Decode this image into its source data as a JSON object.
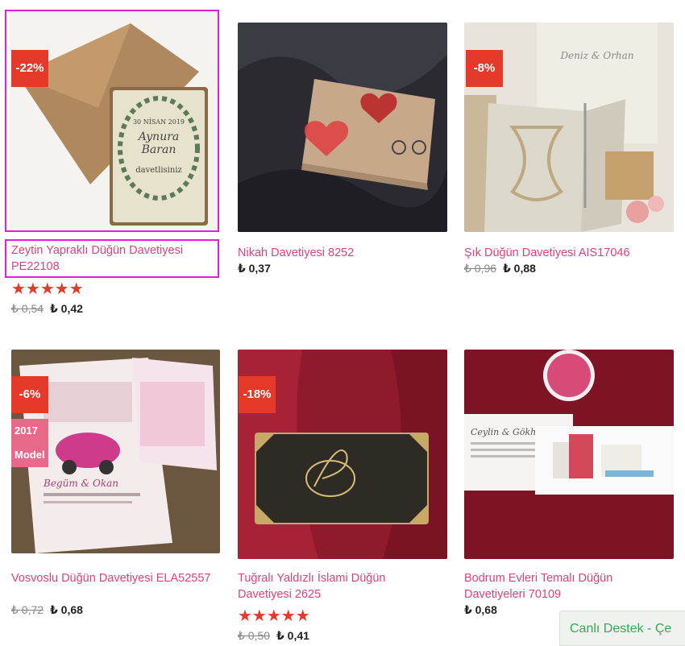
{
  "products": [
    {
      "title": "Zeytin Yapraklı Düğün Davetiyesi PE22108",
      "discount": "-22%",
      "old_price": "₺ 0,54",
      "new_price": "₺ 0,42",
      "stars": "★★★★★"
    },
    {
      "title": "Nikah Davetiyesi 8252",
      "new_price": "₺ 0,37"
    },
    {
      "title": "Şık Düğün Davetiyesi AIS17046",
      "discount": "-8%",
      "old_price": "₺ 0,96",
      "new_price": "₺ 0,88"
    },
    {
      "title": "Vosvoslu Düğün Davetiyesi ELA52557",
      "discount": "-6%",
      "model": "2017 Model",
      "old_price": "₺ 0,72",
      "new_price": "₺ 0,68"
    },
    {
      "title": "Tuğralı Yaldızlı İslami Düğün Davetiyesi 2625",
      "discount": "-18%",
      "old_price": "₺ 0,50",
      "new_price": "₺ 0,41",
      "stars": "★★★★★"
    },
    {
      "title": "Bodrum Evleri Temalı Düğün Davetiyeleri 70109",
      "new_price": "₺ 0,68"
    }
  ],
  "support": {
    "label": "Canlı Destek - Çe"
  },
  "colors": {
    "accent": "#e0407a",
    "badge": "#e5392a",
    "selection": "#e21ed8",
    "support_text": "#35a853"
  }
}
